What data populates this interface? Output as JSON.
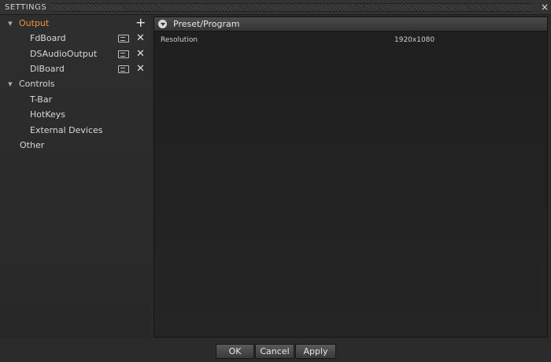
{
  "window": {
    "title": "SETTINGS",
    "close_icon": "×"
  },
  "tree": {
    "output": {
      "label": "Output",
      "add_icon": "+"
    },
    "output_children": [
      {
        "label": "FdBoard"
      },
      {
        "label": "DSAudioOutput"
      },
      {
        "label": "DlBoard"
      }
    ],
    "controls": {
      "label": "Controls"
    },
    "controls_children": [
      {
        "label": "T-Bar"
      },
      {
        "label": "HotKeys"
      },
      {
        "label": "External Devices"
      }
    ],
    "other": {
      "label": "Other"
    },
    "remove_icon": "✕"
  },
  "panel": {
    "title": "Preset/Program",
    "properties": [
      {
        "name": "Resolution",
        "value": "1920x1080"
      }
    ]
  },
  "buttons": {
    "ok": "OK",
    "cancel": "Cancel",
    "apply": "Apply"
  },
  "colors": {
    "accent": "#f0933a"
  }
}
